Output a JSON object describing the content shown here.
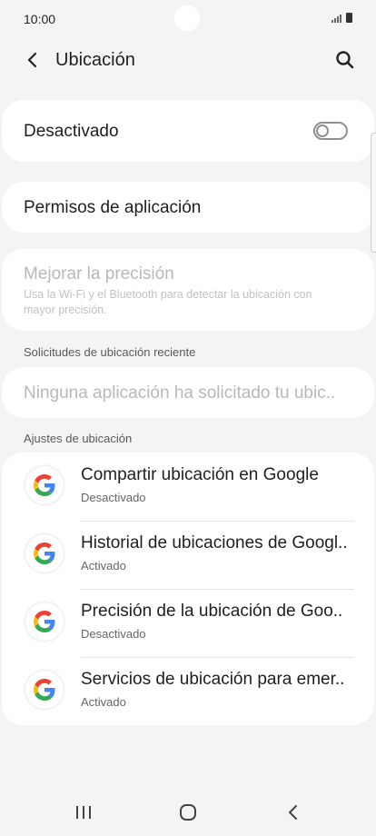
{
  "status_bar": {
    "time": "10:00"
  },
  "header": {
    "title": "Ubicación"
  },
  "location_toggle": {
    "label": "Desactivado",
    "enabled": false
  },
  "app_permissions": {
    "label": "Permisos de aplicación"
  },
  "improve_accuracy": {
    "title": "Mejorar la precisión",
    "description": "Usa la Wi-Fi y el Bluetooth para detectar la ubicación con mayor precisión."
  },
  "recent_requests": {
    "section_title": "Solicitudes de ubicación reciente",
    "empty_text": "Ninguna aplicación ha solicitado tu ubic.."
  },
  "location_settings": {
    "section_title": "Ajustes de ubicación",
    "items": [
      {
        "title": "Compartir ubicación en Google",
        "status": "Desactivado",
        "icon": "google-icon"
      },
      {
        "title": "Historial de ubicaciones de Googl..",
        "status": "Activado",
        "icon": "google-icon"
      },
      {
        "title": "Precisión de la ubicación de Goo..",
        "status": "Desactivado",
        "icon": "google-icon"
      },
      {
        "title": "Servicios de ubicación para emer..",
        "status": "Activado",
        "icon": "google-icon"
      }
    ]
  },
  "colors": {
    "background": "#f4f4f4",
    "card": "#ffffff",
    "google_blue": "#4285F4",
    "google_red": "#EA4335",
    "google_yellow": "#FBBC05",
    "google_green": "#34A853"
  }
}
